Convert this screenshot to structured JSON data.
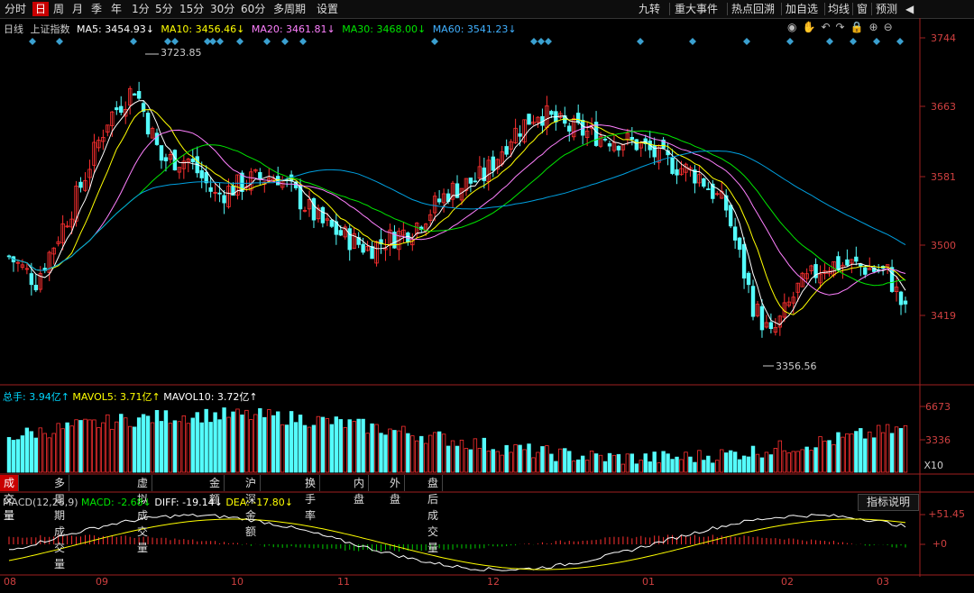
{
  "toolbar": {
    "left": [
      "分时",
      "日",
      "周",
      "月",
      "季",
      "年",
      "1分",
      "5分",
      "15分",
      "30分",
      "60分",
      "多周期",
      "设置"
    ],
    "active_index": 1,
    "right": [
      "九转",
      "重大事件",
      "热点回溯",
      "加自选",
      "均线",
      "窗",
      "预测"
    ]
  },
  "main_info": {
    "period": "日线",
    "index_name": "上证指数",
    "ma5": "MA5: 3454.93↓",
    "ma10": "MA10: 3456.46↓",
    "ma20": "MA20: 3461.81↓",
    "ma30": "MA30: 3468.00↓",
    "ma60": "MA60: 3541.23↓"
  },
  "price_axis": [
    "3744",
    "3663",
    "3581",
    "3500",
    "3419"
  ],
  "price_annotations": {
    "high": "3723.85",
    "low": "3356.56"
  },
  "volume_info": {
    "total": "总手: 3.94亿↑",
    "mavol5": "MAVOL5: 3.71亿↑",
    "mavol10": "MAVOL10: 3.72亿↑"
  },
  "volume_axis": [
    "6673",
    "3336",
    "X10"
  ],
  "tabs": [
    "成交量",
    "多周期成交量",
    "虚拟成交量",
    "金额",
    "沪深金额",
    "换手率",
    "内盘",
    "外盘",
    "盘后成交量"
  ],
  "active_tab": 0,
  "macd_info": {
    "label": "MACD(12,26,9)",
    "macd": "MACD: -2.68↓",
    "diff": "DIFF: -19.14↓",
    "dea": "DEA: -17.80↓"
  },
  "macd_axis": [
    "+51.45",
    "+0"
  ],
  "explain_button": "指标说明",
  "dates": [
    "08",
    "09",
    "10",
    "11",
    "12",
    "01",
    "02",
    "03"
  ],
  "colors": {
    "up": "#ff3030",
    "down": "#54fcfc",
    "ma5": "#ffffff",
    "ma10": "#ffff00",
    "ma20": "#ff80ff",
    "ma30": "#00e600",
    "ma60": "#00a0e0",
    "axis": "#d04040"
  }
}
